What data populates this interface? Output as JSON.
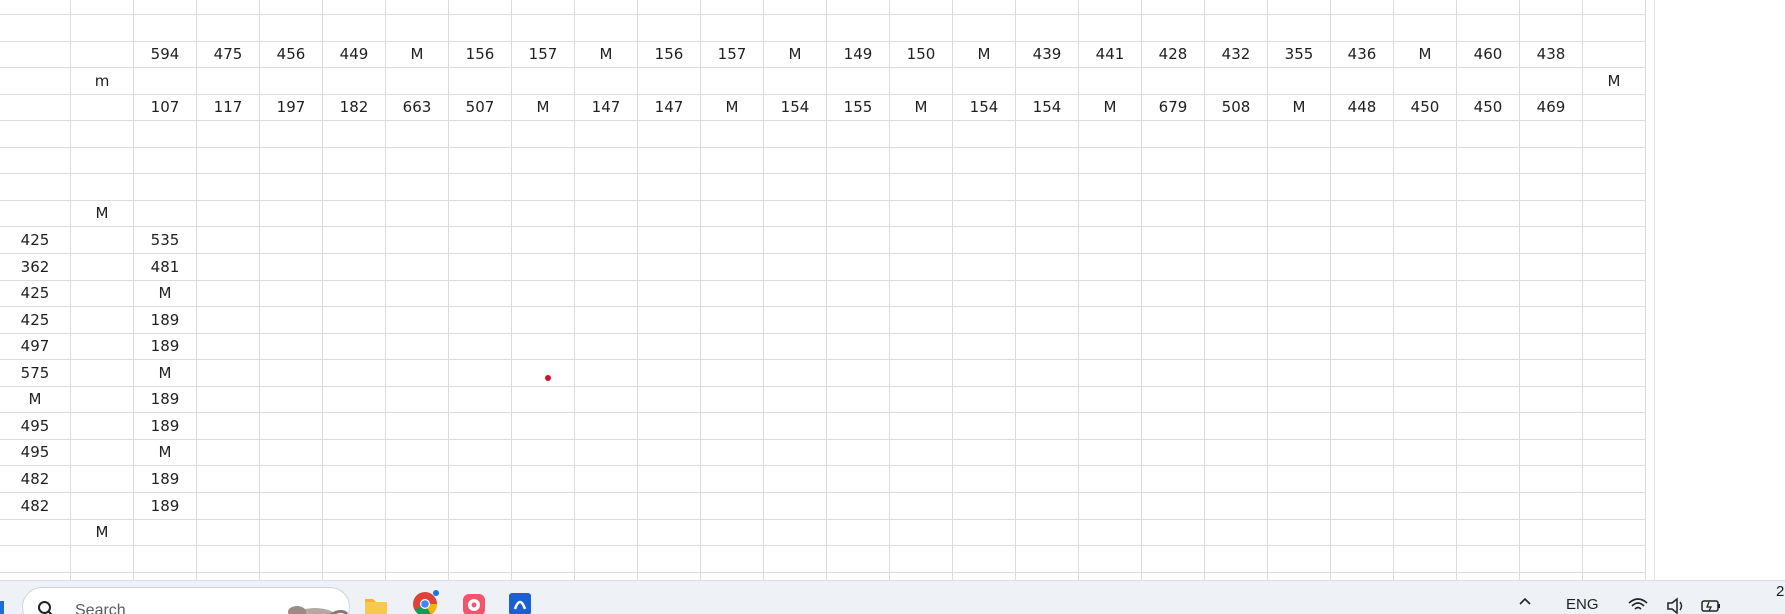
{
  "sheet": {
    "rows": [
      [
        "",
        "",
        "",
        "",
        "",
        "",
        "",
        "",
        "",
        "",
        "",
        "",
        "",
        "",
        "",
        "",
        "",
        "",
        "",
        "",
        "",
        "",
        "",
        "",
        "",
        ""
      ],
      [
        "",
        "",
        "",
        "",
        "",
        "",
        "",
        "",
        "",
        "",
        "",
        "",
        "",
        "",
        "",
        "",
        "",
        "",
        "",
        "",
        "",
        "",
        "",
        "",
        "",
        ""
      ],
      [
        "",
        "",
        "594",
        "475",
        "456",
        "449",
        "M",
        "156",
        "157",
        "M",
        "156",
        "157",
        "M",
        "149",
        "150",
        "M",
        "439",
        "441",
        "428",
        "432",
        "355",
        "436",
        "M",
        "460",
        "438",
        ""
      ],
      [
        "",
        "m",
        "",
        "",
        "",
        "",
        "",
        "",
        "",
        "",
        "",
        "",
        "",
        "",
        "",
        "",
        "",
        "",
        "",
        "",
        "",
        "",
        "",
        "",
        "",
        "M"
      ],
      [
        "",
        "",
        "107",
        "117",
        "197",
        "182",
        "663",
        "507",
        "M",
        "147",
        "147",
        "M",
        "154",
        "155",
        "M",
        "154",
        "154",
        "M",
        "679",
        "508",
        "M",
        "448",
        "450",
        "450",
        "469",
        ""
      ],
      [
        "",
        "",
        "",
        "",
        "",
        "",
        "",
        "",
        "",
        "",
        "",
        "",
        "",
        "",
        "",
        "",
        "",
        "",
        "",
        "",
        "",
        "",
        "",
        "",
        "",
        ""
      ],
      [
        "",
        "",
        "",
        "",
        "",
        "",
        "",
        "",
        "",
        "",
        "",
        "",
        "",
        "",
        "",
        "",
        "",
        "",
        "",
        "",
        "",
        "",
        "",
        "",
        "",
        ""
      ],
      [
        "",
        "",
        "",
        "",
        "",
        "",
        "",
        "",
        "",
        "",
        "",
        "",
        "",
        "",
        "",
        "",
        "",
        "",
        "",
        "",
        "",
        "",
        "",
        "",
        "",
        ""
      ],
      [
        "",
        "M",
        "",
        "",
        "",
        "",
        "",
        "",
        "",
        "",
        "",
        "",
        "",
        "",
        "",
        "",
        "",
        "",
        "",
        "",
        "",
        "",
        "",
        "",
        "",
        ""
      ],
      [
        "425",
        "",
        "535",
        "",
        "",
        "",
        "",
        "",
        "",
        "",
        "",
        "",
        "",
        "",
        "",
        "",
        "",
        "",
        "",
        "",
        "",
        "",
        "",
        "",
        "",
        ""
      ],
      [
        "362",
        "",
        "481",
        "",
        "",
        "",
        "",
        "",
        "",
        "",
        "",
        "",
        "",
        "",
        "",
        "",
        "",
        "",
        "",
        "",
        "",
        "",
        "",
        "",
        "",
        ""
      ],
      [
        "425",
        "",
        "M",
        "",
        "",
        "",
        "",
        "",
        "",
        "",
        "",
        "",
        "",
        "",
        "",
        "",
        "",
        "",
        "",
        "",
        "",
        "",
        "",
        "",
        "",
        ""
      ],
      [
        "425",
        "",
        "189",
        "",
        "",
        "",
        "",
        "",
        "",
        "",
        "",
        "",
        "",
        "",
        "",
        "",
        "",
        "",
        "",
        "",
        "",
        "",
        "",
        "",
        "",
        ""
      ],
      [
        "497",
        "",
        "189",
        "",
        "",
        "",
        "",
        "",
        "",
        "",
        "",
        "",
        "",
        "",
        "",
        "",
        "",
        "",
        "",
        "",
        "",
        "",
        "",
        "",
        "",
        ""
      ],
      [
        "575",
        "",
        "M",
        "",
        "",
        "",
        "",
        "",
        "",
        "",
        "",
        "",
        "",
        "",
        "",
        "",
        "",
        "",
        "",
        "",
        "",
        "",
        "",
        "",
        "",
        ""
      ],
      [
        "M",
        "",
        "189",
        "",
        "",
        "",
        "",
        "",
        "",
        "",
        "",
        "",
        "",
        "",
        "",
        "",
        "",
        "",
        "",
        "",
        "",
        "",
        "",
        "",
        "",
        ""
      ],
      [
        "495",
        "",
        "189",
        "",
        "",
        "",
        "",
        "",
        "",
        "",
        "",
        "",
        "",
        "",
        "",
        "",
        "",
        "",
        "",
        "",
        "",
        "",
        "",
        "",
        "",
        ""
      ],
      [
        "495",
        "",
        "M",
        "",
        "",
        "",
        "",
        "",
        "",
        "",
        "",
        "",
        "",
        "",
        "",
        "",
        "",
        "",
        "",
        "",
        "",
        "",
        "",
        "",
        "",
        ""
      ],
      [
        "482",
        "",
        "189",
        "",
        "",
        "",
        "",
        "",
        "",
        "",
        "",
        "",
        "",
        "",
        "",
        "",
        "",
        "",
        "",
        "",
        "",
        "",
        "",
        "",
        "",
        ""
      ],
      [
        "482",
        "",
        "189",
        "",
        "",
        "",
        "",
        "",
        "",
        "",
        "",
        "",
        "",
        "",
        "",
        "",
        "",
        "",
        "",
        "",
        "",
        "",
        "",
        "",
        "",
        ""
      ],
      [
        "",
        "M",
        "",
        "",
        "",
        "",
        "",
        "",
        "",
        "",
        "",
        "",
        "",
        "",
        "",
        "",
        "",
        "",
        "",
        "",
        "",
        "",
        "",
        "",
        "",
        ""
      ],
      [
        "",
        "",
        "",
        "",
        "",
        "",
        "",
        "",
        "",
        "",
        "",
        "",
        "",
        "",
        "",
        "",
        "",
        "",
        "",
        "",
        "",
        "",
        "",
        "",
        "",
        ""
      ],
      [
        "",
        "",
        "",
        "",
        "",
        "",
        "",
        "",
        "",
        "",
        "",
        "",
        "",
        "",
        "",
        "",
        "",
        "",
        "",
        "",
        "",
        "",
        "",
        "",
        "",
        ""
      ]
    ]
  },
  "taskbar": {
    "search_placeholder": "Search",
    "language": "ENG",
    "clock_partial": "2",
    "icons": {
      "search": "search-icon",
      "file_explorer": "folder-icon",
      "chrome": "chrome-icon",
      "music": "music-app-icon",
      "store": "blue-app-icon",
      "tray_expand": "chevron-up-icon",
      "network": "wifi-icon",
      "volume": "speaker-icon",
      "battery": "battery-icon"
    }
  },
  "colors": {
    "gridline": "#dcdcdc",
    "taskbar_bg": "#eef1f6",
    "cursor_dot": "#d4102a",
    "folder": "#f2b32a",
    "chrome_accent": "#1a73e8"
  }
}
